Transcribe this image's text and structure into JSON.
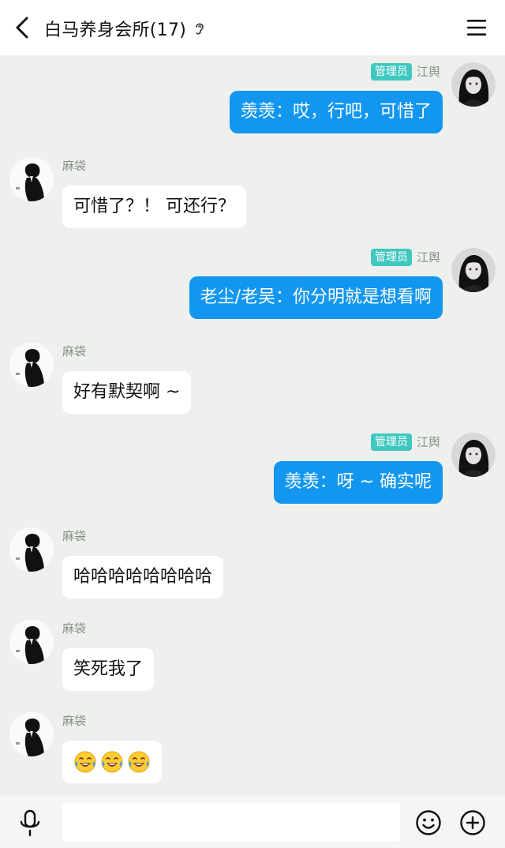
{
  "header": {
    "title": "白马养身会所(17)",
    "back_icon": "chevron-left-icon",
    "mode_icon": "ear-icon",
    "menu_icon": "hamburger-menu-icon"
  },
  "messages": [
    {
      "direction": "out",
      "role": "管理员",
      "sender": "江舆",
      "text": "羡羡：哎，行吧，可惜了"
    },
    {
      "direction": "in",
      "sender": "麻袋",
      "text": "可惜了？！ 可还行？"
    },
    {
      "direction": "out",
      "role": "管理员",
      "sender": "江舆",
      "text": "老尘/老吴：你分明就是想看啊"
    },
    {
      "direction": "in",
      "sender": "麻袋",
      "text": "好有默契啊 ~"
    },
    {
      "direction": "out",
      "role": "管理员",
      "sender": "江舆",
      "text": "羡羡：呀 ~ 确实呢"
    },
    {
      "direction": "in",
      "sender": "麻袋",
      "text": "哈哈哈哈哈哈哈哈"
    },
    {
      "direction": "in",
      "sender": "麻袋",
      "text": "笑死我了"
    },
    {
      "direction": "in",
      "sender": "麻袋",
      "emoji": [
        "face-with-tears-of-joy-icon",
        "face-with-tears-of-joy-icon",
        "face-with-tears-of-joy-icon"
      ]
    }
  ],
  "input_bar": {
    "voice_icon": "microphone-icon",
    "input_value": "",
    "emoji_icon": "smiley-icon",
    "more_icon": "plus-circle-icon"
  },
  "colors": {
    "outgoing_bubble": "#1296f0",
    "incoming_bubble": "#ffffff",
    "chat_background": "#edf0ec",
    "admin_badge": "#40c8c0"
  }
}
